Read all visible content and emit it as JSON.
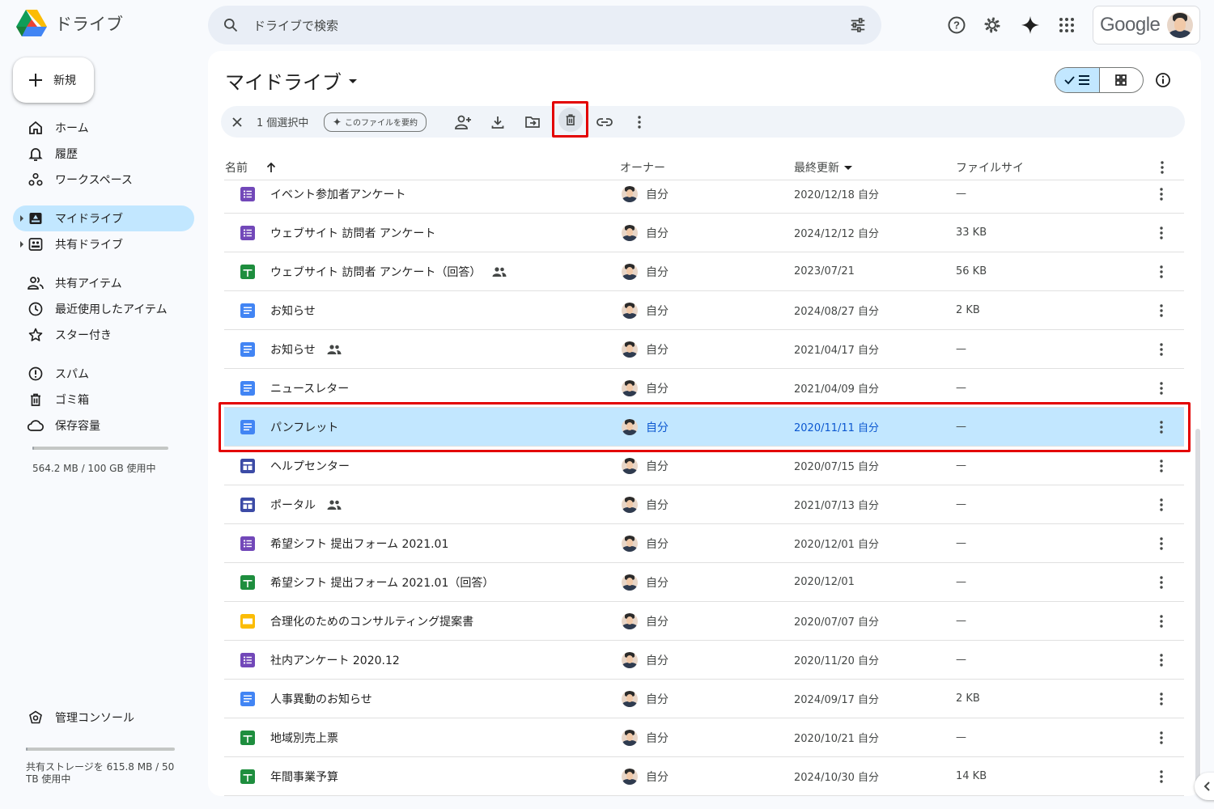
{
  "app": {
    "title": "ドライブ"
  },
  "search": {
    "placeholder": "ドライブで検索"
  },
  "account": {
    "brand": "Google"
  },
  "sidebar": {
    "new_label": "新規",
    "items": [
      {
        "label": "ホーム",
        "icon": "home-icon"
      },
      {
        "label": "履歴",
        "icon": "bell-icon"
      },
      {
        "label": "ワークスペース",
        "icon": "workspaces-icon"
      },
      {
        "label": "マイドライブ",
        "icon": "my-drive-icon",
        "active": true
      },
      {
        "label": "共有ドライブ",
        "icon": "shared-drive-icon"
      },
      {
        "label": "共有アイテム",
        "icon": "people-icon"
      },
      {
        "label": "最近使用したアイテム",
        "icon": "clock-icon"
      },
      {
        "label": "スター付き",
        "icon": "star-icon"
      },
      {
        "label": "スパム",
        "icon": "spam-icon"
      },
      {
        "label": "ゴミ箱",
        "icon": "trash-icon"
      },
      {
        "label": "保存容量",
        "icon": "cloud-icon"
      }
    ],
    "storage_text": "564.2 MB / 100 GB 使用中",
    "storage_used_fraction": 0.006,
    "admin_label": "管理コンソール",
    "shared_storage_text": "共有ストレージを 615.8 MB / 50 TB 使用中",
    "shared_storage_fraction": 0.01
  },
  "main": {
    "title": "マイドライブ",
    "selection": {
      "count_text": "1 個選択中",
      "summarize_label": "このファイルを要約"
    },
    "columns": {
      "name": "名前",
      "owner": "オーナー",
      "modified": "最終更新",
      "size": "ファイルサイ"
    },
    "rows": [
      {
        "name": "イベント参加者アンケート",
        "type": "forms",
        "shared": false,
        "owner": "自分",
        "modified": "2020/12/18 自分",
        "size": "—"
      },
      {
        "name": "ウェブサイト 訪問者 アンケート",
        "type": "forms",
        "shared": false,
        "owner": "自分",
        "modified": "2024/12/12 自分",
        "size": "33 KB"
      },
      {
        "name": "ウェブサイト 訪問者 アンケート（回答）",
        "type": "sheets",
        "shared": true,
        "owner": "自分",
        "modified": "2023/07/21",
        "size": "56 KB"
      },
      {
        "name": "お知らせ",
        "type": "docs",
        "shared": false,
        "owner": "自分",
        "modified": "2024/08/27 自分",
        "size": "2 KB"
      },
      {
        "name": "お知らせ",
        "type": "docs",
        "shared": true,
        "owner": "自分",
        "modified": "2021/04/17 自分",
        "size": "—"
      },
      {
        "name": "ニュースレター",
        "type": "docs",
        "shared": false,
        "owner": "自分",
        "modified": "2021/04/09 自分",
        "size": "—"
      },
      {
        "name": "パンフレット",
        "type": "docs",
        "shared": false,
        "owner": "自分",
        "modified": "2020/11/11 自分",
        "size": "—",
        "selected": true
      },
      {
        "name": "ヘルプセンター",
        "type": "sites",
        "shared": false,
        "owner": "自分",
        "modified": "2020/07/15 自分",
        "size": "—"
      },
      {
        "name": "ポータル",
        "type": "sites",
        "shared": true,
        "owner": "自分",
        "modified": "2021/07/13 自分",
        "size": "—"
      },
      {
        "name": "希望シフト 提出フォーム 2021.01",
        "type": "forms",
        "shared": false,
        "owner": "自分",
        "modified": "2020/12/01 自分",
        "size": "—"
      },
      {
        "name": "希望シフト 提出フォーム 2021.01（回答）",
        "type": "sheets",
        "shared": false,
        "owner": "自分",
        "modified": "2020/12/01",
        "size": "—"
      },
      {
        "name": "合理化のためのコンサルティング提案書",
        "type": "slides",
        "shared": false,
        "owner": "自分",
        "modified": "2020/07/07 自分",
        "size": "—"
      },
      {
        "name": "社内アンケート 2020.12",
        "type": "forms",
        "shared": false,
        "owner": "自分",
        "modified": "2020/11/20 自分",
        "size": "—"
      },
      {
        "name": "人事異動のお知らせ",
        "type": "docs",
        "shared": false,
        "owner": "自分",
        "modified": "2024/09/17 自分",
        "size": "2 KB"
      },
      {
        "name": "地域別売上票",
        "type": "sheets",
        "shared": false,
        "owner": "自分",
        "modified": "2020/10/21 自分",
        "size": "—"
      },
      {
        "name": "年間事業予算",
        "type": "sheets",
        "shared": false,
        "owner": "自分",
        "modified": "2024/10/30 自分",
        "size": "14 KB"
      }
    ]
  },
  "colors": {
    "forms": "#7248b9",
    "sheets": "#1e8e3e",
    "docs": "#4285f4",
    "sites": "#3c4ba6",
    "slides": "#fbbc04",
    "selected_row": "#c2e7ff",
    "highlight": "#e30000"
  }
}
